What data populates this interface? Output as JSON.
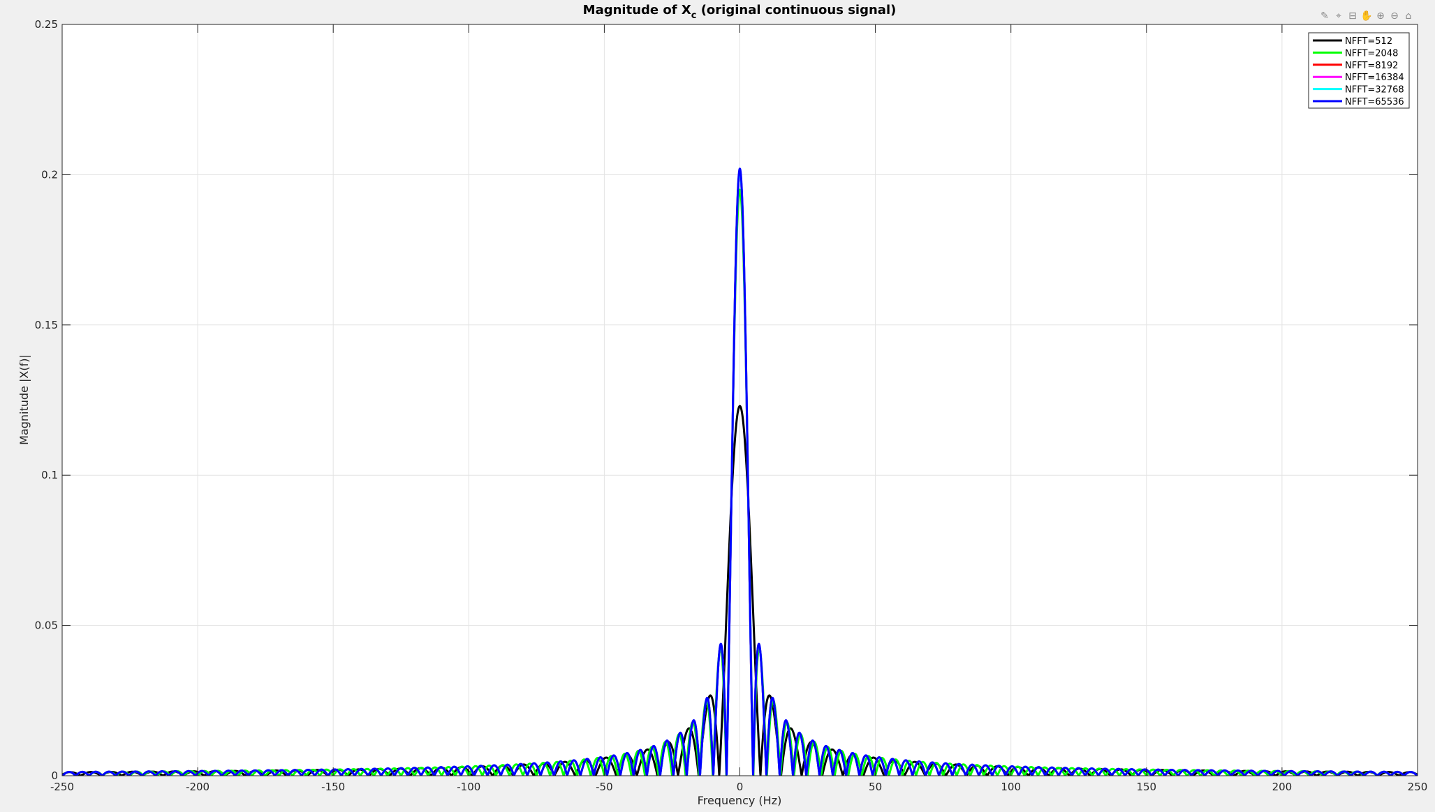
{
  "toolbar": {
    "buttons": [
      {
        "icon": "brush-icon",
        "glyph": "✎"
      },
      {
        "icon": "datatip-icon",
        "glyph": "⌖"
      },
      {
        "icon": "export-icon",
        "glyph": "⊟"
      },
      {
        "icon": "pan-icon",
        "glyph": "✋"
      },
      {
        "icon": "zoom-in-icon",
        "glyph": "⊕"
      },
      {
        "icon": "zoom-out-icon",
        "glyph": "⊖"
      },
      {
        "icon": "home-icon",
        "glyph": "⌂"
      }
    ]
  },
  "chart_data": {
    "type": "line",
    "title_main": "Magnitude of X",
    "title_sub": "c",
    "title_rest": " (original continuous signal)",
    "xlabel": "Frequency (Hz)",
    "ylabel": "Magnitude |X(f)|",
    "xlim": [
      -250,
      250
    ],
    "ylim": [
      0,
      0.25
    ],
    "xticks": [
      -250,
      -200,
      -150,
      -100,
      -50,
      0,
      50,
      100,
      150,
      200,
      250
    ],
    "xtick_labels": [
      "-250",
      "-200",
      "-150",
      "-100",
      "-50",
      "0",
      "50",
      "100",
      "150",
      "200",
      "250"
    ],
    "yticks": [
      0,
      0.05,
      0.1,
      0.15,
      0.2,
      0.25
    ],
    "ytick_labels": [
      "0",
      "0.05",
      "0.1",
      "0.15",
      "0.2",
      "0.25"
    ],
    "grid": true,
    "legend_position": "top-right",
    "series": [
      {
        "name": "NFFT=512",
        "color": "#000000",
        "peak": 0.123,
        "lobe_width": 7.6
      },
      {
        "name": "NFFT=2048",
        "color": "#00ff00",
        "peak": 0.195,
        "lobe_width": 5.0
      },
      {
        "name": "NFFT=8192",
        "color": "#ff0000",
        "peak": 0.201,
        "lobe_width": 4.9
      },
      {
        "name": "NFFT=16384",
        "color": "#ff00ff",
        "peak": 0.201,
        "lobe_width": 4.9
      },
      {
        "name": "NFFT=32768",
        "color": "#00ffff",
        "peak": 0.201,
        "lobe_width": 4.9
      },
      {
        "name": "NFFT=65536",
        "color": "#0000ff",
        "peak": 0.202,
        "lobe_width": 4.9
      }
    ]
  }
}
